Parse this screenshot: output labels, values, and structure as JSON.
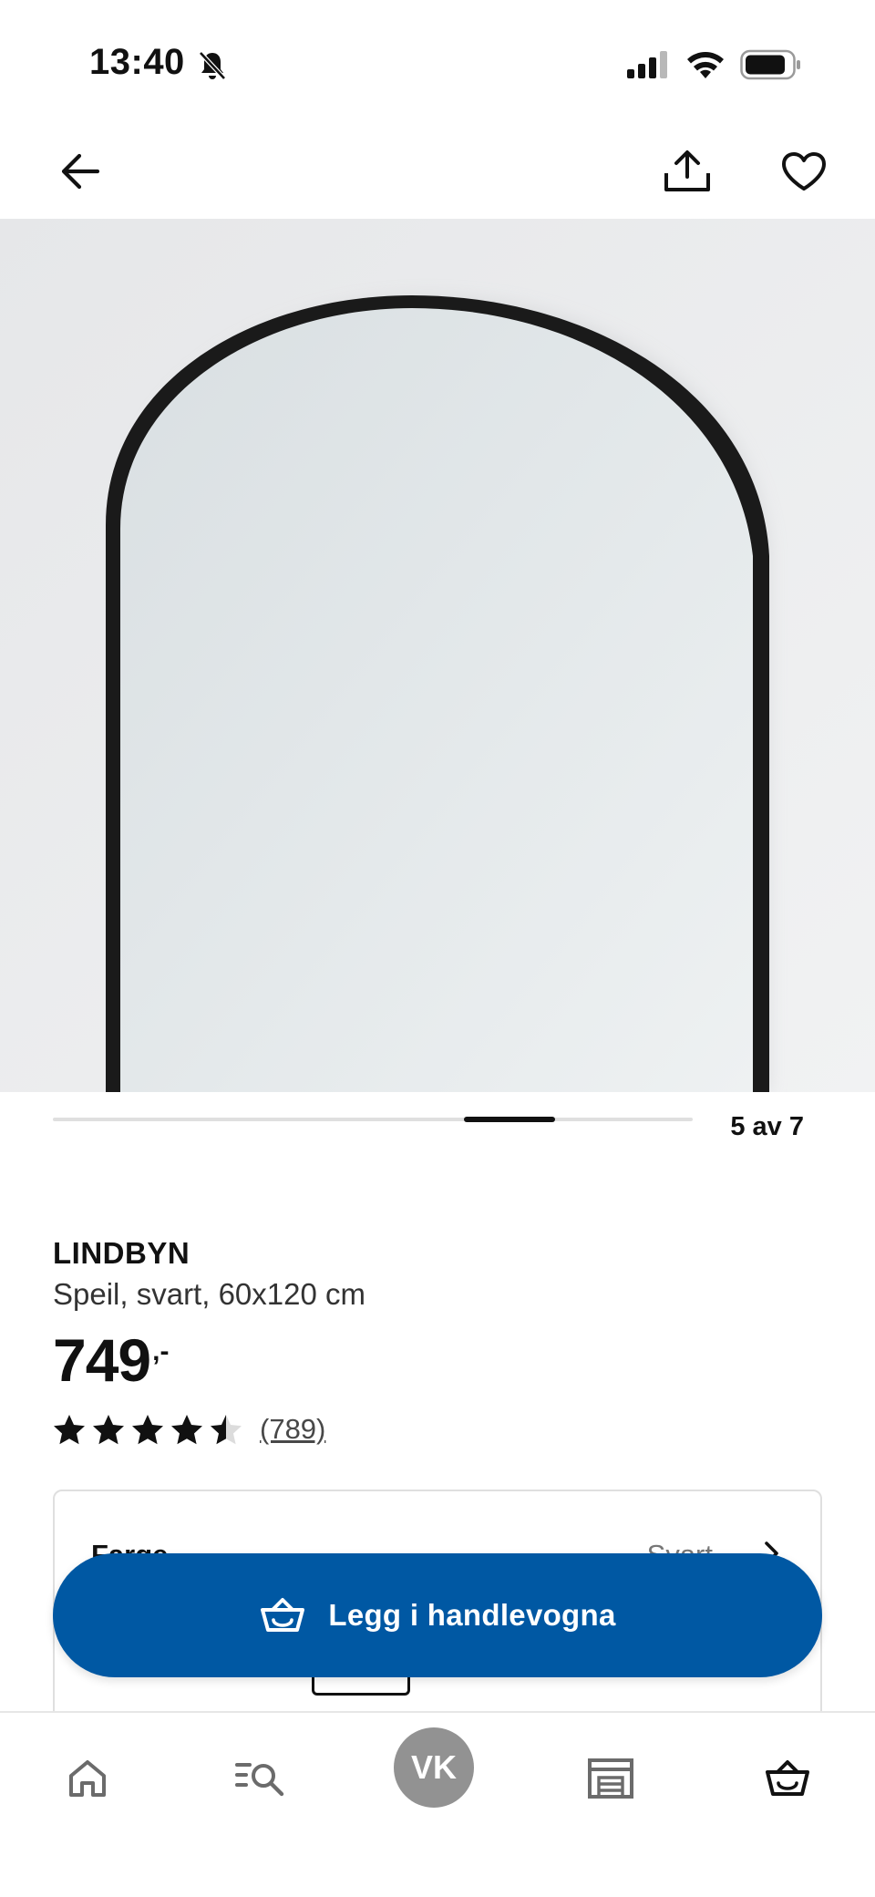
{
  "status_bar": {
    "time": "13:40",
    "icons": [
      "bell-slash-icon",
      "cellular-signal-icon",
      "wifi-icon",
      "battery-icon"
    ]
  },
  "nav": {
    "icons": [
      "arrow-left-icon",
      "share-icon",
      "heart-icon"
    ]
  },
  "gallery": {
    "current": 5,
    "total": 7,
    "counter_text": "5 av 7",
    "progress_fraction": 0.714
  },
  "product": {
    "name": "LINDBYN",
    "description": "Speil, svart, 60x120 cm",
    "price": "749",
    "price_suffix": ",-",
    "rating": 4.5,
    "rating_max": 5,
    "review_count": "(789)"
  },
  "color_selector": {
    "label": "Farge",
    "value": "Svart"
  },
  "add_to_cart": {
    "label": "Legg i handlevogna"
  },
  "tab_bar": {
    "profile_initials": "VK",
    "icons": [
      "home-icon",
      "search-list-icon",
      "profile-avatar",
      "store-icon",
      "cart-basket-icon"
    ]
  },
  "colors": {
    "primary_blue": "#0058a3",
    "text": "#111111",
    "muted": "#767676",
    "avatar_gray": "#929292"
  }
}
